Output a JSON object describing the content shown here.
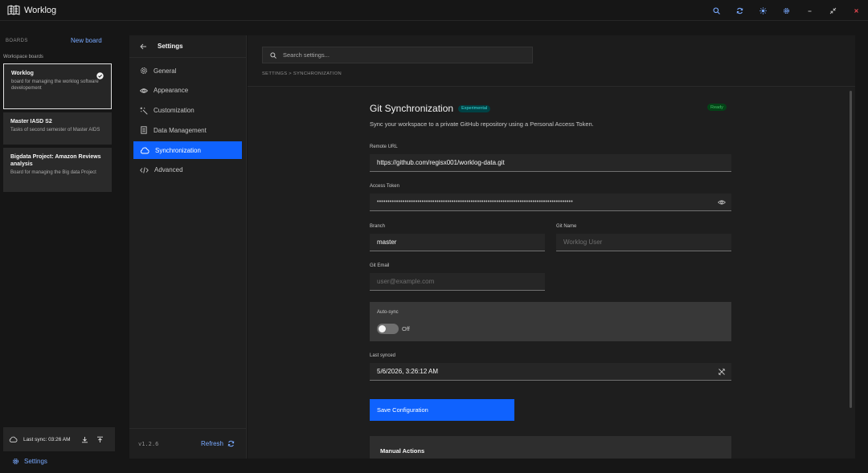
{
  "app": {
    "title": "Worklog"
  },
  "sidebar": {
    "boards_heading": "BOARDS",
    "new_board": "New board",
    "workspace_label": "Workspace boards",
    "boards": [
      {
        "title": "Worklog",
        "description": "board for managing the worklog software developement",
        "active": true
      },
      {
        "title": "Master IASD S2",
        "description": "Tasks of second semester of Master AIDS",
        "active": false
      },
      {
        "title": "Bigdata Project: Amazon Reviews analysis",
        "description": "Board for managing the Big data Project",
        "active": false
      }
    ],
    "last_sync": "Last sync: 03:26 AM",
    "settings_label": "Settings"
  },
  "settings": {
    "title": "Settings",
    "nav": [
      {
        "label": "General",
        "icon": "gear-icon"
      },
      {
        "label": "Appearance",
        "icon": "eye-icon"
      },
      {
        "label": "Customization",
        "icon": "magic-wand-icon"
      },
      {
        "label": "Data Management",
        "icon": "document-icon"
      },
      {
        "label": "Synchronization",
        "icon": "cloud-icon",
        "active": true
      },
      {
        "label": "Advanced",
        "icon": "code-icon"
      }
    ],
    "version": "v1.2.6",
    "refresh": "Refresh"
  },
  "main": {
    "search_placeholder": "Search settings...",
    "breadcrumb": "SETTINGS > SYNCHRONIZATION",
    "git": {
      "title": "Git Synchronization",
      "badge_experimental": "Experimental",
      "badge_status": "Ready",
      "subtitle": "Sync your workspace to a private GitHub repository using a Personal Access Token.",
      "remote_url_label": "Remote URL",
      "remote_url_value": "https://github.com/regisx001/worklog-data.git",
      "access_token_label": "Access Token",
      "access_token_value": "••••••••••••••••••••••••••••••••••••••••••••••••••••••••••••••••••••••••••••••••••••••••••••",
      "branch_label": "Branch",
      "branch_value": "master",
      "git_name_label": "Git Name",
      "git_name_placeholder": "Worklog User",
      "git_email_label": "Git Email",
      "git_email_placeholder": "user@example.com",
      "autosync_label": "Auto-sync",
      "autosync_state": "Off",
      "last_synced_label": "Last synced",
      "last_synced_value": "5/6/2026, 3:26:12 AM",
      "save_button": "Save Configuration",
      "manual_actions": "Manual Actions"
    }
  },
  "colors": {
    "accent": "#0f62fe",
    "link": "#78a9ff",
    "ready": "#42be65",
    "experimental": "#3ddbd9"
  }
}
